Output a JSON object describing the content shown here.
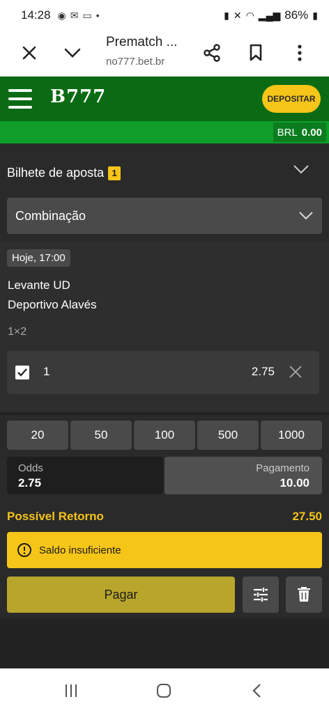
{
  "status_bar": {
    "time": "14:28",
    "battery": "86%"
  },
  "browser": {
    "title": "Prematch ...",
    "url": "no777.bet.br"
  },
  "site": {
    "logo": "B777",
    "deposit_label": "DEPOSITAR",
    "currency": "BRL",
    "balance": "0.00",
    "brand_color": "#0a6b14",
    "accent_color": "#f5c518"
  },
  "betslip": {
    "title": "Bilhete de aposta",
    "count": "1",
    "bet_type": "Combinação"
  },
  "event": {
    "time": "Hoje, 17:00",
    "home": "Levante UD",
    "away": "Deportivo Alavés",
    "market": "1×2",
    "selection": "1",
    "odds": "2.75"
  },
  "stakes": {
    "quick": [
      "20",
      "50",
      "100",
      "500",
      "1000"
    ],
    "odds_label": "Odds",
    "odds_value": "2.75",
    "payment_label": "Pagamento",
    "payment_value": "10.00"
  },
  "return": {
    "label": "Possível Retorno",
    "value": "27.50"
  },
  "alert": {
    "text": "Saldo insuficiente"
  },
  "actions": {
    "pay_label": "Pagar"
  },
  "icons": {
    "close": "close-icon",
    "chevron": "chevron-down-icon",
    "share": "share-icon",
    "bookmark": "bookmark-icon",
    "menu": "more-vert-icon",
    "settings": "sliders-icon",
    "delete": "trash-icon",
    "warning": "warning-icon"
  }
}
